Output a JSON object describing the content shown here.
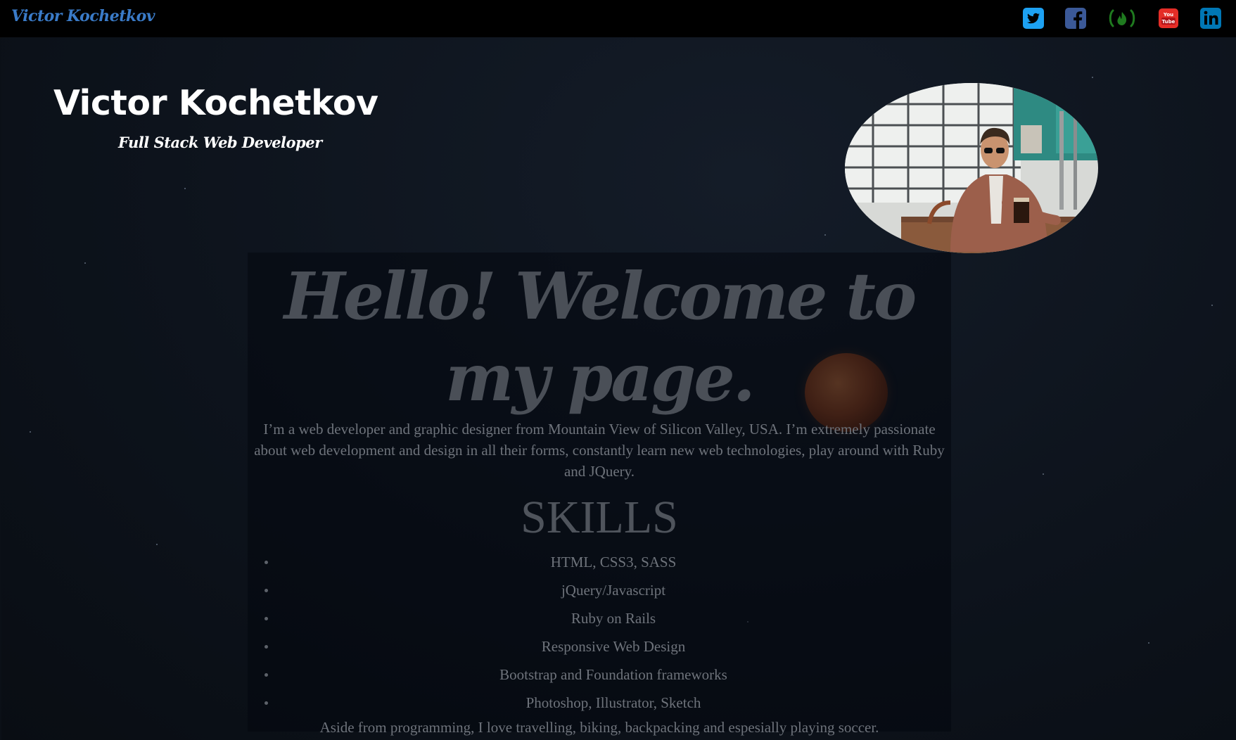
{
  "nav": {
    "brand": "Victor Kochetkov",
    "social": [
      {
        "icon": "twitter-icon",
        "color": "#1da1f2"
      },
      {
        "icon": "facebook-icon",
        "color": "#3b5998"
      },
      {
        "icon": "freecodecamp-icon",
        "color": "#1f7a1f"
      },
      {
        "icon": "youtube-icon",
        "color": "#e52d27"
      },
      {
        "icon": "linkedin-icon",
        "color": "#0077b5"
      }
    ]
  },
  "hero": {
    "name": "Victor Kochetkov",
    "role": "Full Stack Web Developer"
  },
  "main": {
    "welcome": "Hello! Welcome to my page.",
    "intro": "I’m a web developer and graphic designer from Mountain View of Silicon Valley, USA. I’m extremely passionate about web development and design in all their forms, constantly learn new web technologies, play around with Ruby and JQuery.",
    "skills_title": "SKILLS",
    "skills": [
      "HTML, CSS3, SASS",
      "jQuery/Javascript",
      "Ruby on Rails",
      "Responsive Web Design",
      "Bootstrap and Foundation frameworks",
      "Photoshop, Illustrator, Sketch"
    ],
    "outro": "Aside from programming, I love travelling, biking, backpacking and espesially playing soccer."
  }
}
